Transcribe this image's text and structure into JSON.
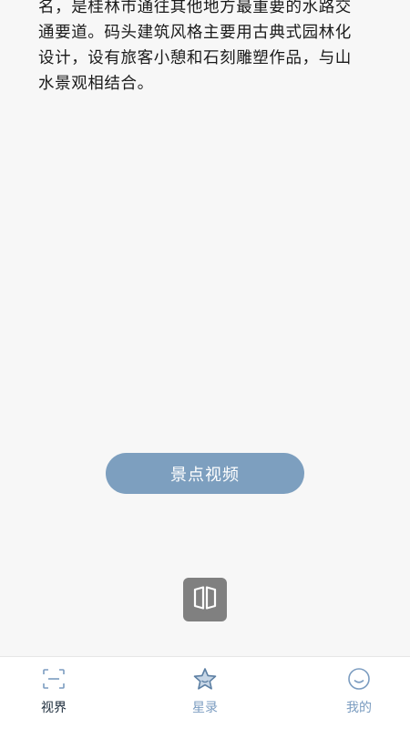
{
  "content": {
    "paragraph_lines": [
      "名，是桂林市通往其他地方最重要的水路交",
      "通要道。码头建筑风格主要用古典式园林化",
      "设计，设有旅客小憩和石刻雕塑作品，与山",
      "水景观相结合。"
    ]
  },
  "actions": {
    "video_button_label": "景点视频",
    "book_icon": "book-open-icon"
  },
  "tabbar": {
    "tabs": [
      {
        "label": "视界",
        "icon": "scan-frame-icon",
        "active": true
      },
      {
        "label": "星录",
        "icon": "star-icon",
        "active": false
      },
      {
        "label": "我的",
        "icon": "smile-face-icon",
        "active": false
      }
    ]
  },
  "colors": {
    "accent": "#7d9fbf",
    "tab_inactive": "#7b9cc0",
    "tab_active": "#1a2a3a",
    "book_button_bg": "#808080"
  }
}
